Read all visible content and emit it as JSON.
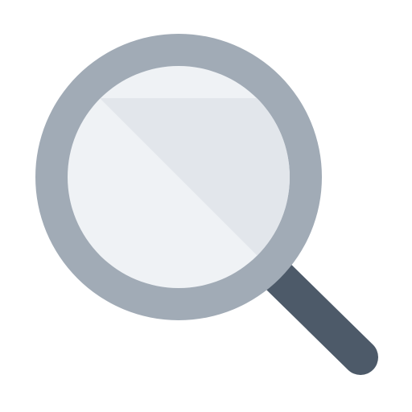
{
  "icon": {
    "name": "magnifying-glass-icon",
    "colors": {
      "background": "#ffffff",
      "rim": "#a1abb6",
      "lens_light": "#eff2f5",
      "lens_shade": "#e2e6eb",
      "handle": "#4d5a69"
    }
  }
}
